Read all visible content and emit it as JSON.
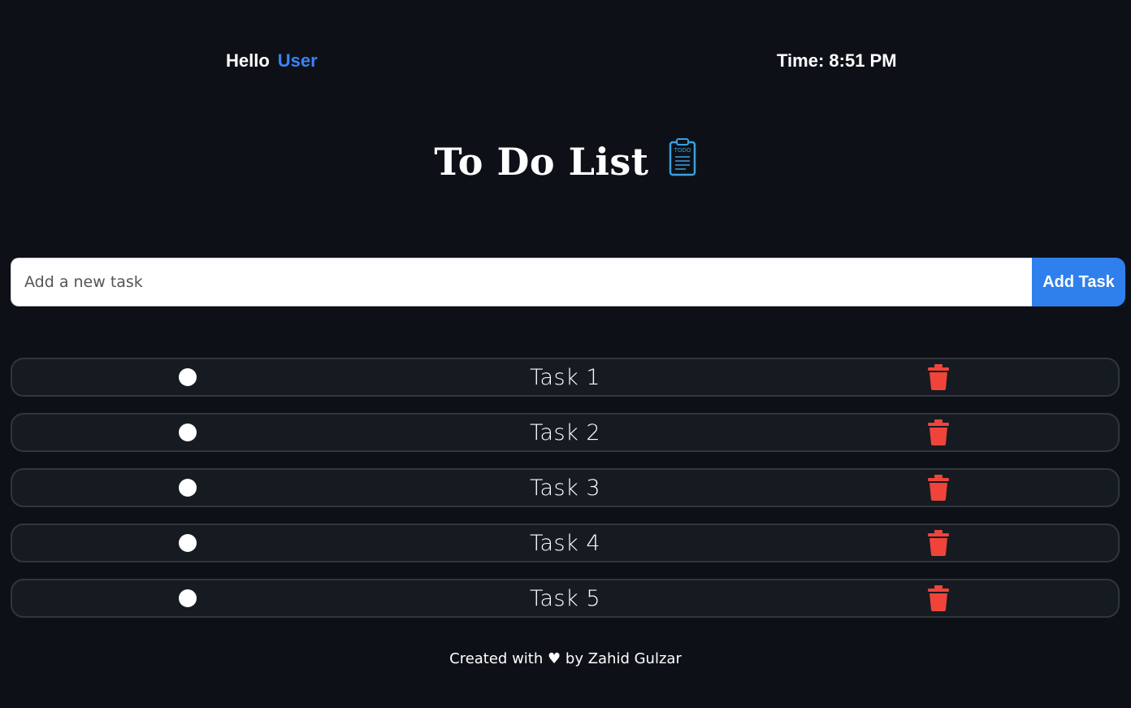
{
  "header": {
    "greeting": "Hello",
    "user_name": "User",
    "time_label": "Time:",
    "time_value": "8:51 PM"
  },
  "title": {
    "text": "To Do List",
    "icon": "clipboard-todo-icon",
    "icon_text": "TODO"
  },
  "input": {
    "placeholder": "Add a new task",
    "value": "",
    "button_label": "Add Task"
  },
  "tasks": [
    {
      "label": "Task 1",
      "completed": false
    },
    {
      "label": "Task 2",
      "completed": false
    },
    {
      "label": "Task 3",
      "completed": false
    },
    {
      "label": "Task 4",
      "completed": false
    },
    {
      "label": "Task 5",
      "completed": false
    }
  ],
  "footer": {
    "prefix": "Created with",
    "heart": "♥",
    "suffix": "by Zahid Gulzar"
  },
  "colors": {
    "background": "#0d1117",
    "accent": "#3b82f6",
    "button": "#2f80ed",
    "delete": "#f0443a",
    "row_bg": "#161b22",
    "row_border": "#30363d"
  }
}
